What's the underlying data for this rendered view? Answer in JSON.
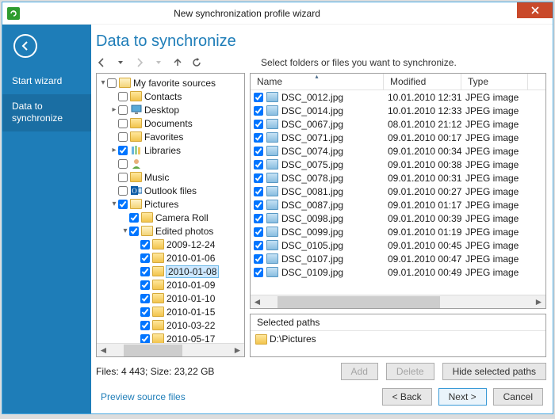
{
  "window": {
    "title": "New synchronization profile wizard"
  },
  "sidebar": {
    "items": [
      {
        "label": "Start wizard",
        "active": false
      },
      {
        "label": "Data to\nsynchronize",
        "active": true
      }
    ]
  },
  "page": {
    "title": "Data to synchronize",
    "instruction": "Select folders or files you want to synchronize."
  },
  "tree": {
    "nodes": [
      {
        "indent": 0,
        "arrow": "open",
        "checked": false,
        "icon": "folder-open",
        "label": "My favorite sources"
      },
      {
        "indent": 1,
        "arrow": "none",
        "checked": false,
        "icon": "folder",
        "label": "Contacts"
      },
      {
        "indent": 1,
        "arrow": "closed",
        "checked": false,
        "icon": "desktop",
        "label": "Desktop"
      },
      {
        "indent": 1,
        "arrow": "none",
        "checked": false,
        "icon": "folder",
        "label": "Documents"
      },
      {
        "indent": 1,
        "arrow": "none",
        "checked": false,
        "icon": "folder",
        "label": "Favorites"
      },
      {
        "indent": 1,
        "arrow": "closed",
        "checked": true,
        "icon": "libraries",
        "label": "Libraries"
      },
      {
        "indent": 1,
        "arrow": "none",
        "checked": false,
        "icon": "user",
        "label": ""
      },
      {
        "indent": 1,
        "arrow": "none",
        "checked": false,
        "icon": "folder",
        "label": "Music"
      },
      {
        "indent": 1,
        "arrow": "none",
        "checked": false,
        "icon": "outlook",
        "label": "Outlook files"
      },
      {
        "indent": 1,
        "arrow": "open",
        "checked": true,
        "icon": "folder-open",
        "label": "Pictures"
      },
      {
        "indent": 2,
        "arrow": "none",
        "checked": true,
        "icon": "folder",
        "label": "Camera Roll"
      },
      {
        "indent": 2,
        "arrow": "open",
        "checked": true,
        "icon": "folder-open",
        "label": "Edited photos"
      },
      {
        "indent": 3,
        "arrow": "none",
        "checked": true,
        "icon": "folder",
        "label": "2009-12-24"
      },
      {
        "indent": 3,
        "arrow": "none",
        "checked": true,
        "icon": "folder",
        "label": "2010-01-06"
      },
      {
        "indent": 3,
        "arrow": "none",
        "checked": true,
        "icon": "folder",
        "label": "2010-01-08",
        "selected": true
      },
      {
        "indent": 3,
        "arrow": "none",
        "checked": true,
        "icon": "folder",
        "label": "2010-01-09"
      },
      {
        "indent": 3,
        "arrow": "none",
        "checked": true,
        "icon": "folder",
        "label": "2010-01-10"
      },
      {
        "indent": 3,
        "arrow": "none",
        "checked": true,
        "icon": "folder",
        "label": "2010-01-15"
      },
      {
        "indent": 3,
        "arrow": "none",
        "checked": true,
        "icon": "folder",
        "label": "2010-03-22"
      },
      {
        "indent": 3,
        "arrow": "none",
        "checked": true,
        "icon": "folder",
        "label": "2010-05-17"
      }
    ]
  },
  "files": {
    "columns": {
      "name": "Name",
      "modified": "Modified",
      "type": "Type"
    },
    "col_widths": {
      "name": 168,
      "modified": 98,
      "type": 84
    },
    "rows": [
      {
        "checked": true,
        "name": "DSC_0012.jpg",
        "modified": "10.01.2010 12:31",
        "type": "JPEG image"
      },
      {
        "checked": true,
        "name": "DSC_0014.jpg",
        "modified": "10.01.2010 12:33",
        "type": "JPEG image"
      },
      {
        "checked": true,
        "name": "DSC_0067.jpg",
        "modified": "08.01.2010 21:12",
        "type": "JPEG image"
      },
      {
        "checked": true,
        "name": "DSC_0071.jpg",
        "modified": "09.01.2010 00:17",
        "type": "JPEG image"
      },
      {
        "checked": true,
        "name": "DSC_0074.jpg",
        "modified": "09.01.2010 00:34",
        "type": "JPEG image"
      },
      {
        "checked": true,
        "name": "DSC_0075.jpg",
        "modified": "09.01.2010 00:38",
        "type": "JPEG image"
      },
      {
        "checked": true,
        "name": "DSC_0078.jpg",
        "modified": "09.01.2010 00:31",
        "type": "JPEG image"
      },
      {
        "checked": true,
        "name": "DSC_0081.jpg",
        "modified": "09.01.2010 00:27",
        "type": "JPEG image"
      },
      {
        "checked": true,
        "name": "DSC_0087.jpg",
        "modified": "09.01.2010 01:17",
        "type": "JPEG image"
      },
      {
        "checked": true,
        "name": "DSC_0098.jpg",
        "modified": "09.01.2010 00:39",
        "type": "JPEG image"
      },
      {
        "checked": true,
        "name": "DSC_0099.jpg",
        "modified": "09.01.2010 01:19",
        "type": "JPEG image"
      },
      {
        "checked": true,
        "name": "DSC_0105.jpg",
        "modified": "09.01.2010 00:45",
        "type": "JPEG image"
      },
      {
        "checked": true,
        "name": "DSC_0107.jpg",
        "modified": "09.01.2010 00:47",
        "type": "JPEG image"
      },
      {
        "checked": true,
        "name": "DSC_0109.jpg",
        "modified": "09.01.2010 00:49",
        "type": "JPEG image"
      }
    ]
  },
  "selected_paths": {
    "header": "Selected paths",
    "items": [
      "D:\\Pictures"
    ]
  },
  "status": {
    "text": "Files: 4 443; Size: 23,22 GB"
  },
  "buttons": {
    "add": "Add",
    "delete": "Delete",
    "hide_paths": "Hide selected paths",
    "back": "< Back",
    "next": "Next >",
    "cancel": "Cancel",
    "preview": "Preview source files"
  }
}
